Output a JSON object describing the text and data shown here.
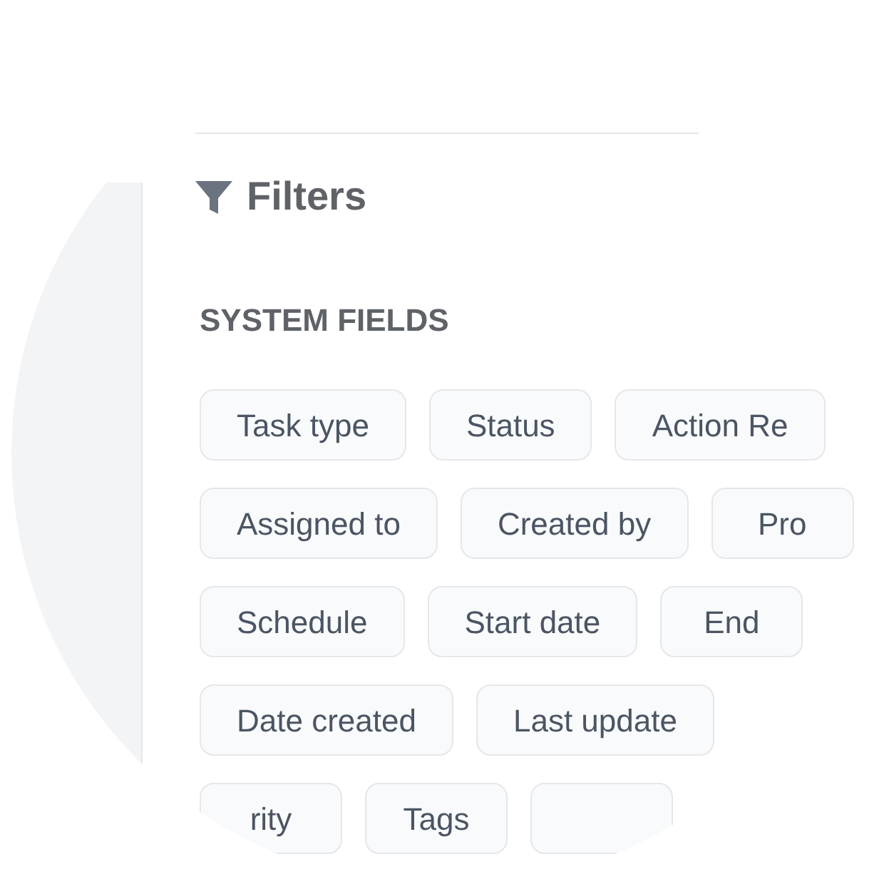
{
  "panel": {
    "title": "Filters",
    "section": "SYSTEM FIELDS",
    "chip_rows": [
      [
        "Task type",
        "Status",
        "Action Re"
      ],
      [
        "Assigned to",
        "Created by",
        "Pro"
      ],
      [
        "Schedule",
        "Start date",
        "End"
      ],
      [
        "Date created",
        "Last update"
      ],
      [
        "rity",
        "Tags",
        ""
      ]
    ]
  }
}
